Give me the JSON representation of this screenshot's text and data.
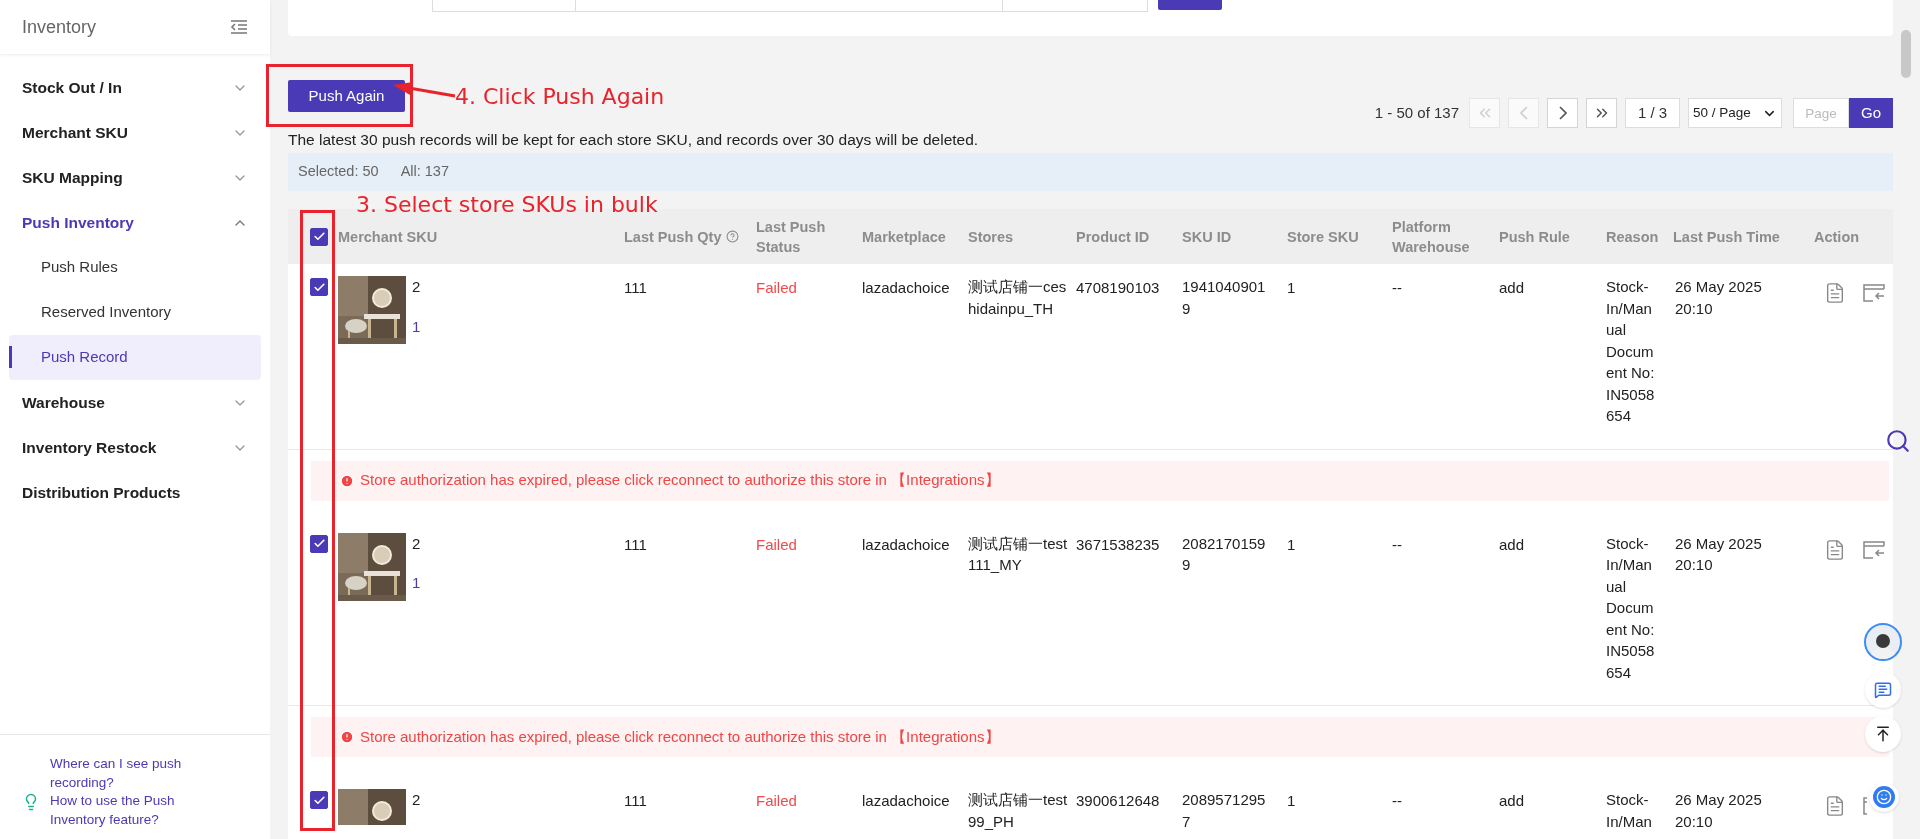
{
  "sidebar": {
    "title": "Inventory",
    "items": [
      {
        "label": "Stock Out / In",
        "kind": "group",
        "expanded": false
      },
      {
        "label": "Merchant SKU",
        "kind": "group",
        "expanded": false
      },
      {
        "label": "SKU Mapping",
        "kind": "group",
        "expanded": false
      },
      {
        "label": "Push Inventory",
        "kind": "group",
        "expanded": true,
        "children": [
          {
            "label": "Push Rules",
            "selected": false
          },
          {
            "label": "Reserved Inventory",
            "selected": false
          },
          {
            "label": "Push Record",
            "selected": true
          }
        ]
      },
      {
        "label": "Warehouse",
        "kind": "group",
        "expanded": false
      },
      {
        "label": "Inventory Restock",
        "kind": "group",
        "expanded": false
      },
      {
        "label": "Distribution Products",
        "kind": "link"
      }
    ],
    "help_links": [
      "Where can I see push recording?",
      "How to use the Push Inventory feature?"
    ]
  },
  "toolbar": {
    "push_button": "Push Again",
    "notice": "The latest 30 push records will be kept for each store SKU, and records over 30 days will be deleted."
  },
  "pagination": {
    "range": "1 - 50 of 137",
    "nav_buttons": [
      {
        "kind": "first",
        "disabled": true
      },
      {
        "kind": "prev",
        "disabled": true
      },
      {
        "kind": "next",
        "disabled": false
      },
      {
        "kind": "last",
        "disabled": false
      }
    ],
    "page": "1 / 3",
    "page_size": "50 / Page",
    "jump": {
      "placeholder": "Page"
    },
    "go": "Go"
  },
  "selection": {
    "selected": "Selected: 50",
    "all": "All: 137"
  },
  "table": {
    "header_checked": true,
    "columns": [
      {
        "label": "Merchant SKU",
        "kind": "plain"
      },
      {
        "label": "Last Push Qty",
        "kind": "help"
      },
      {
        "label": "Last Push Status",
        "kind": "plain"
      },
      {
        "label": "Marketplace",
        "kind": "plain"
      },
      {
        "label": "Stores",
        "kind": "plain"
      },
      {
        "label": "Product ID",
        "kind": "plain"
      },
      {
        "label": "SKU ID",
        "kind": "plain"
      },
      {
        "label": "Store SKU",
        "kind": "plain"
      },
      {
        "label": "Platform Warehouse",
        "kind": "plain"
      },
      {
        "label": "Push Rule",
        "kind": "plain"
      },
      {
        "label": "Reason",
        "kind": "plain"
      },
      {
        "label": "Last Push Time",
        "kind": "plain"
      },
      {
        "label": "Action",
        "kind": "plain"
      }
    ],
    "rows": [
      {
        "checked": true,
        "merchant_sku": "2",
        "merchant_sku_link": "1",
        "last_push_qty": "111",
        "status": "Failed",
        "failed": true,
        "marketplace": "lazadachoice",
        "store": "测试店铺一ceshidainpu_TH",
        "product_id": "4708190103",
        "sku_id": "19410409019",
        "store_sku": "1",
        "platform_warehouse": "--",
        "push_rule": "add",
        "reason": "Stock-In/Manual Document No: IN5058654",
        "time": "26 May 2025 20:10",
        "error": "Store authorization has expired, please click reconnect to authorize this store in 【Integrations】"
      },
      {
        "checked": true,
        "merchant_sku": "2",
        "merchant_sku_link": "1",
        "last_push_qty": "111",
        "status": "Failed",
        "failed": true,
        "marketplace": "lazadachoice",
        "store": "测试店铺一test111_MY",
        "product_id": "3671538235",
        "sku_id": "20821701599",
        "store_sku": "1",
        "platform_warehouse": "--",
        "push_rule": "add",
        "reason": "Stock-In/Manual Document No: IN5058654",
        "time": "26 May 2025 20:10",
        "error": "Store authorization has expired, please click reconnect to authorize this store in 【Integrations】"
      },
      {
        "checked": true,
        "merchant_sku": "2",
        "last_push_qty": "111",
        "status": "Failed",
        "failed": true,
        "marketplace": "lazadachoice",
        "store": "测试店铺一test99_PH",
        "product_id": "3900612648",
        "sku_id": "20895712957",
        "store_sku": "1",
        "platform_warehouse": "--",
        "push_rule": "add",
        "reason": "Stock-In/Man",
        "time": "26 May 2025 20:10"
      }
    ]
  },
  "annotations": [
    {
      "text": "4. Click Push Again",
      "kind": "push"
    },
    {
      "text": "3. Select store SKUs in bulk",
      "kind": "select"
    }
  ]
}
